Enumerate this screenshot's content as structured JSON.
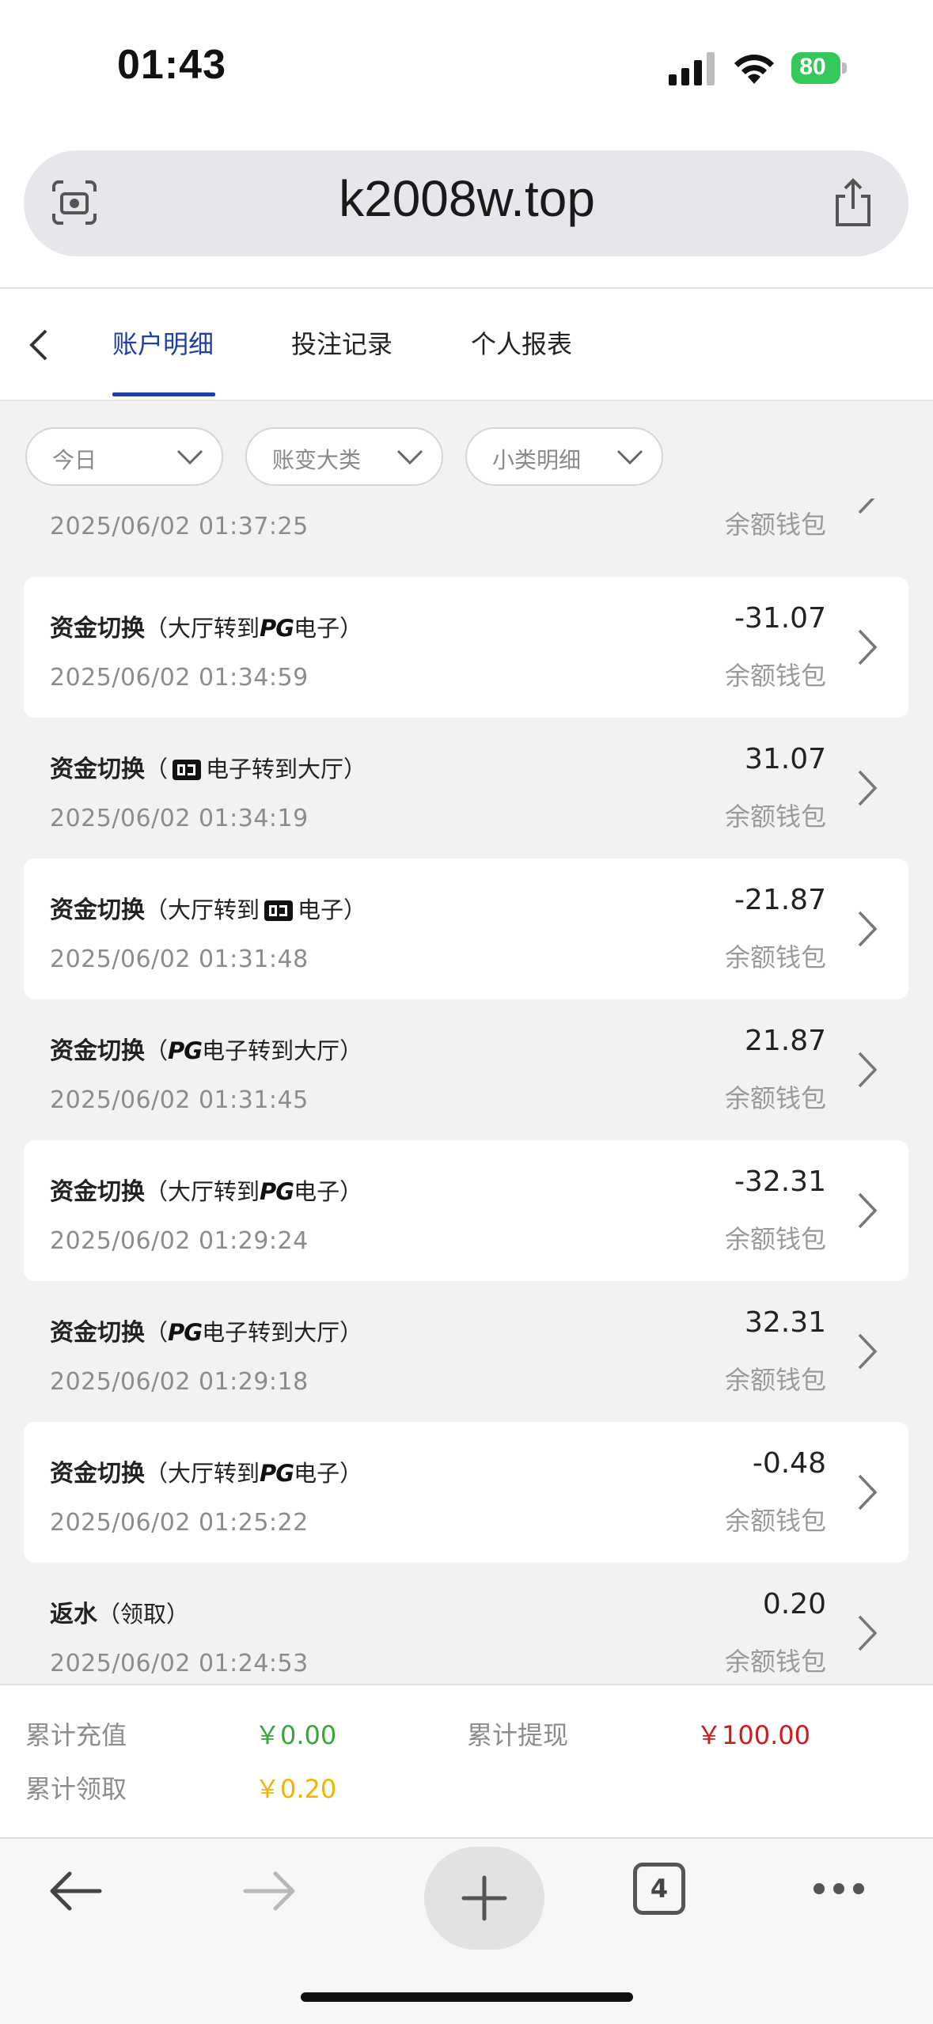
{
  "status": {
    "time": "01:43",
    "battery": "80"
  },
  "browser": {
    "url": "k2008w.top",
    "tab_count": "4"
  },
  "tabs": [
    {
      "label": "账户明细",
      "active": true
    },
    {
      "label": "投注记录",
      "active": false
    },
    {
      "label": "个人报表",
      "active": false
    }
  ],
  "filters": [
    {
      "label": "今日"
    },
    {
      "label": "账变大类"
    },
    {
      "label": "小类明细"
    }
  ],
  "partial_item": {
    "date": "2025/06/02 01:37:25",
    "wallet": "余额钱包"
  },
  "items": [
    {
      "title": "资金切换",
      "paren_open": "（",
      "pre": "大厅转到",
      "brand": "PG",
      "post": "电子）",
      "date": "2025/06/02 01:34:59",
      "amount": "-31.07",
      "wallet": "余额钱包"
    },
    {
      "title": "资金切换",
      "paren_open": "（",
      "pre": "",
      "brand": "box",
      "post": "电子转到大厅）",
      "date": "2025/06/02 01:34:19",
      "amount": "31.07",
      "wallet": "余额钱包"
    },
    {
      "title": "资金切换",
      "paren_open": "（",
      "pre": "大厅转到",
      "brand": "box",
      "post": "电子）",
      "date": "2025/06/02 01:31:48",
      "amount": "-21.87",
      "wallet": "余额钱包"
    },
    {
      "title": "资金切换",
      "paren_open": "（",
      "pre": "",
      "brand": "PG",
      "post": "电子转到大厅）",
      "date": "2025/06/02 01:31:45",
      "amount": "21.87",
      "wallet": "余额钱包"
    },
    {
      "title": "资金切换",
      "paren_open": "（",
      "pre": "大厅转到",
      "brand": "PG",
      "post": "电子）",
      "date": "2025/06/02 01:29:24",
      "amount": "-32.31",
      "wallet": "余额钱包"
    },
    {
      "title": "资金切换",
      "paren_open": "（",
      "pre": "",
      "brand": "PG",
      "post": "电子转到大厅）",
      "date": "2025/06/02 01:29:18",
      "amount": "32.31",
      "wallet": "余额钱包"
    },
    {
      "title": "资金切换",
      "paren_open": "（",
      "pre": "大厅转到",
      "brand": "PG",
      "post": "电子）",
      "date": "2025/06/02 01:25:22",
      "amount": "-0.48",
      "wallet": "余额钱包"
    },
    {
      "title": "返水",
      "paren_open": "（",
      "pre": "领取）",
      "brand": "",
      "post": "",
      "date": "2025/06/02 01:24:53",
      "amount": "0.20",
      "wallet": "余额钱包"
    }
  ],
  "summary": {
    "deposit_label": "累计充值",
    "deposit_value": "￥0.00",
    "deposit_color": "#3aa63a",
    "withdraw_label": "累计提现",
    "withdraw_value": "￥100.00",
    "withdraw_color": "#d31a1a",
    "claim_label": "累计领取",
    "claim_value": "￥0.20",
    "claim_color": "#f2b400"
  },
  "colors": {
    "accent": "#1e3fa8"
  }
}
